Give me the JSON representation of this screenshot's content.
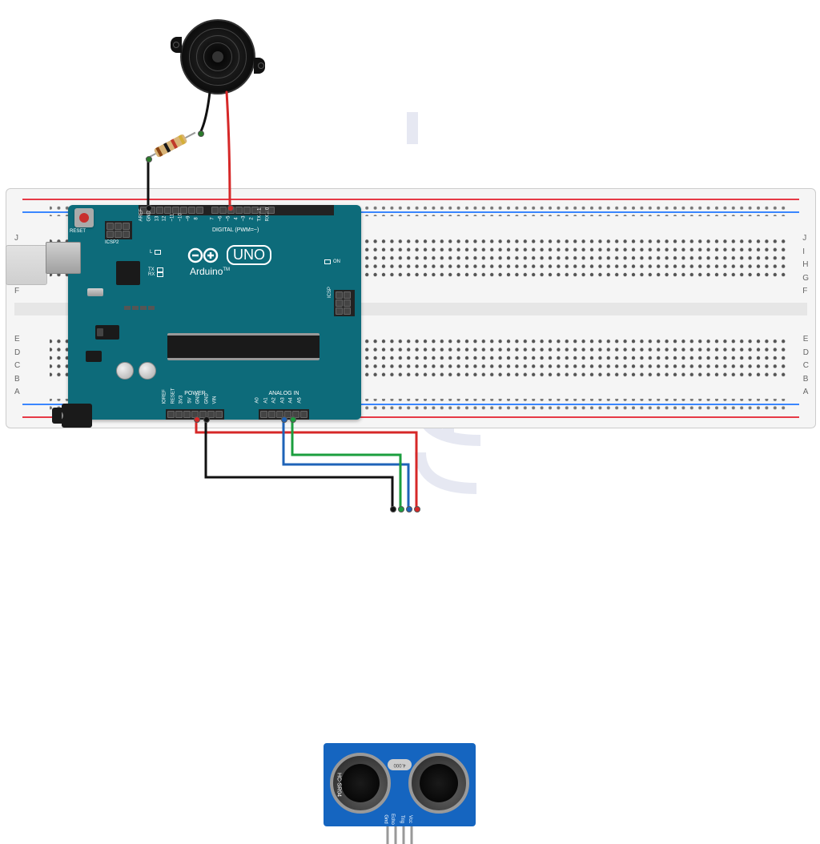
{
  "arduino": {
    "brand": "Arduino",
    "model": "UNO",
    "tm": "TM",
    "reset_label": "RESET",
    "icsp2_label": "ICSP2",
    "icsp_label": "ICSP",
    "on_label": "ON",
    "leds": {
      "l": "L",
      "tx": "TX",
      "rx": "RX"
    },
    "digital_label": "DIGITAL (PWM=~)",
    "power_label": "POWER",
    "analog_label": "ANALOG IN",
    "digital_pins": [
      "AREF",
      "GND",
      "13",
      "12",
      "~11",
      "~10",
      "~9",
      "8",
      "",
      "7",
      "~6",
      "~5",
      "4",
      "~3",
      "2",
      "TX→1",
      "RX←0"
    ],
    "power_pins": [
      "IOREF",
      "RESET",
      "3V3",
      "5V",
      "GND",
      "GND",
      "VIN"
    ],
    "analog_pins": [
      "A0",
      "A1",
      "A2",
      "A3",
      "A4",
      "A5"
    ]
  },
  "hcsr04": {
    "name": "HC-SR04",
    "osc": "4.000",
    "pins": [
      "Vcc",
      "Trig",
      "Echo",
      "Gnd"
    ]
  },
  "buzzer": {
    "name": "piezo-buzzer"
  },
  "resistor": {
    "name": "resistor",
    "bands": [
      "#8b4513",
      "#1a1a1a",
      "#c0392b",
      "#d4af37"
    ]
  },
  "wires": {
    "buzzer_pos": {
      "color": "red",
      "from": "buzzer-positive",
      "to": "arduino-digital-8"
    },
    "buzzer_neg": {
      "color": "black",
      "from": "buzzer-negative",
      "to": "resistor-lead-a"
    },
    "resistor_gnd": {
      "color": "black",
      "from": "resistor-lead-b",
      "to": "arduino-digital-gnd"
    },
    "sr04_vcc": {
      "color": "red",
      "from": "arduino-5v",
      "to": "hcsr04-vcc"
    },
    "sr04_trig": {
      "color": "blue",
      "from": "arduino-a2",
      "to": "hcsr04-trig"
    },
    "sr04_echo": {
      "color": "green",
      "from": "arduino-a3",
      "to": "hcsr04-echo"
    },
    "sr04_gnd": {
      "color": "black",
      "from": "arduino-power-gnd",
      "to": "hcsr04-gnd"
    }
  },
  "breadboard": {
    "rows_top": [
      "J",
      "I",
      "H",
      "G",
      "F"
    ],
    "rows_bot": [
      "E",
      "D",
      "C",
      "B",
      "A"
    ]
  },
  "watermark": {
    "hint": "stylized lightbulb logo"
  }
}
